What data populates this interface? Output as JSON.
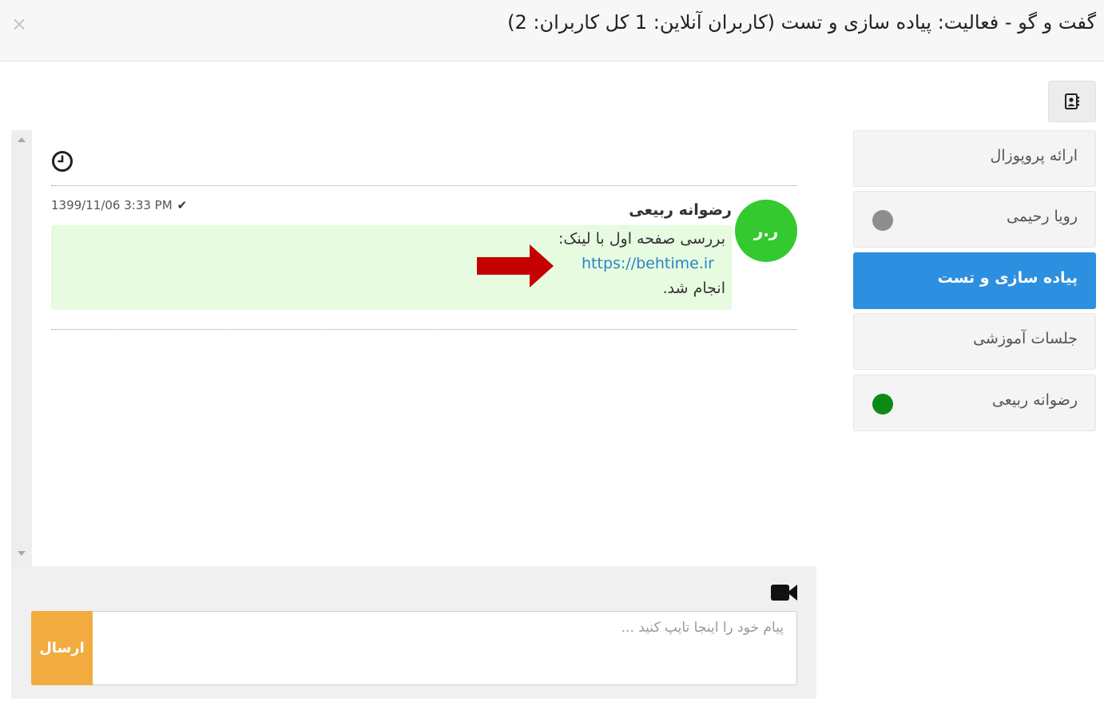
{
  "header": {
    "title": "گفت و گو - فعالیت: پیاده سازی و تست (کاربران آنلاین: 1 کل کاربران: 2)",
    "close_glyph": "×"
  },
  "sidebar": {
    "contacts_icon": "contact-book-icon",
    "items": [
      {
        "label": "ارائه پروپوزال",
        "active": false,
        "status": null
      },
      {
        "label": "رویا رحیمی",
        "active": false,
        "status": "offline",
        "status_color": "#8e8e8e"
      },
      {
        "label": "پیاده سازی و تست",
        "active": true,
        "status": null
      },
      {
        "label": "جلسات آموزشی",
        "active": false,
        "status": null
      },
      {
        "label": "رضوانه ربیعی",
        "active": false,
        "status": "online",
        "status_color": "#0d8a16"
      }
    ]
  },
  "chat": {
    "messages": [
      {
        "sender": "رضوانه ربیعی",
        "avatar_initials": "ر.ر",
        "timestamp": "1399/11/06 3:33 PM",
        "check_glyph": "✔",
        "line1": "بررسی صفحه اول با لینک:",
        "link": "https://behtime.ir",
        "line3": "انجام شد."
      }
    ]
  },
  "composer": {
    "placeholder": "پیام خود را اینجا تایپ کنید ...",
    "value": "",
    "send_label": "ارسال"
  },
  "colors": {
    "active_tab": "#2d8fe0",
    "avatar": "#34c92e",
    "bubble": "#e6fbdf",
    "send_button": "#f2ab3e",
    "annotation_arrow": "#c40000",
    "link": "#2a84c8"
  }
}
